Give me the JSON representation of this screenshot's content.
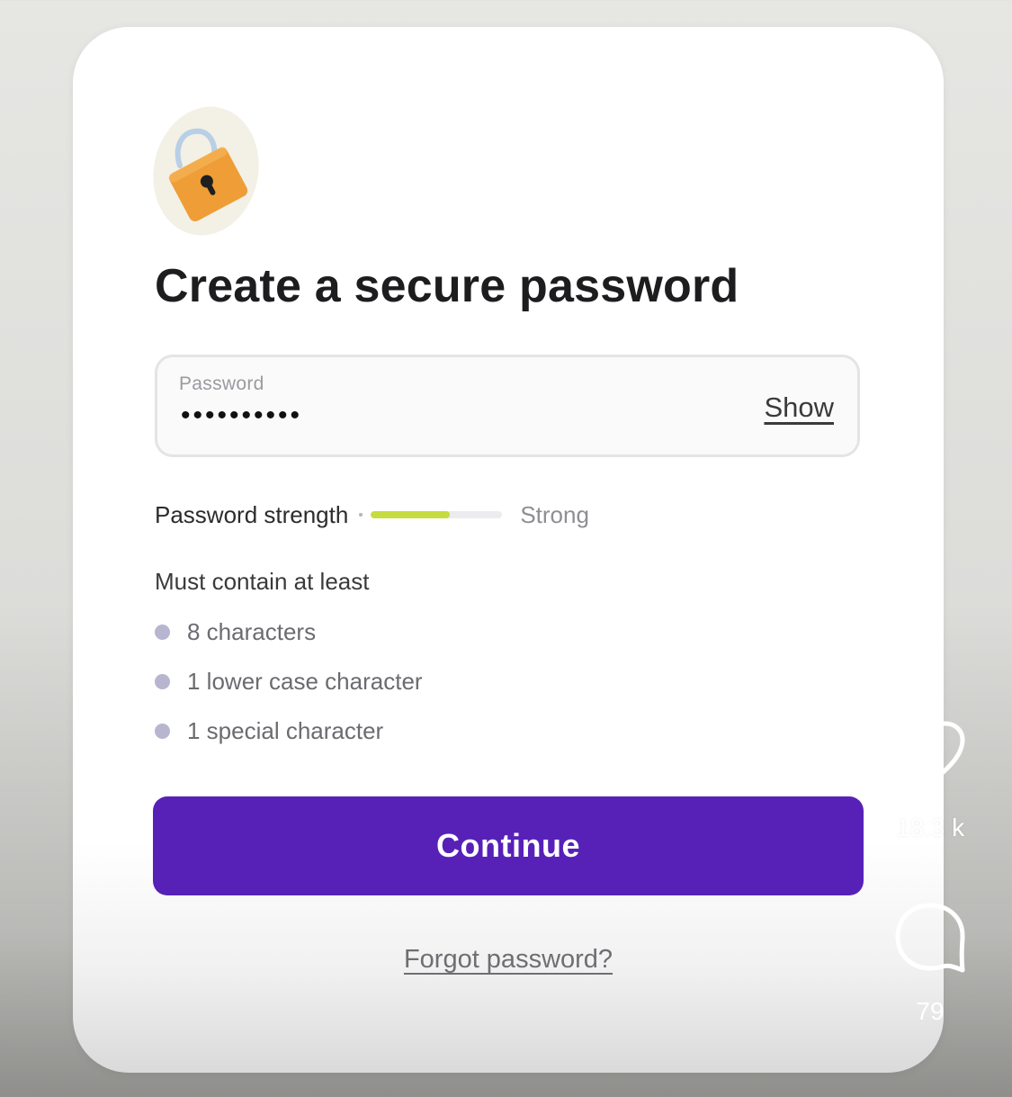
{
  "card": {
    "title": "Create a secure password",
    "lock_icon": "padlock-icon"
  },
  "password_field": {
    "label": "Password",
    "value": "••••••••••",
    "show_label": "Show"
  },
  "strength": {
    "label": "Password strength",
    "level_fraction": 0.6,
    "level_text": "Strong",
    "meter_color": "#c6dc3e"
  },
  "requirements": {
    "heading": "Must contain at least",
    "items": [
      {
        "label": "8 characters"
      },
      {
        "label": "1 lower case character"
      },
      {
        "label": "1 special character"
      }
    ]
  },
  "continue_button": {
    "label": "Continue",
    "color": "#5721b8"
  },
  "forgot_link": {
    "label": "Forgot password?"
  },
  "social": {
    "like_icon": "heart-icon",
    "like_count": "18.3 k",
    "comment_icon": "comment-bubble-icon",
    "comment_count": "79"
  }
}
